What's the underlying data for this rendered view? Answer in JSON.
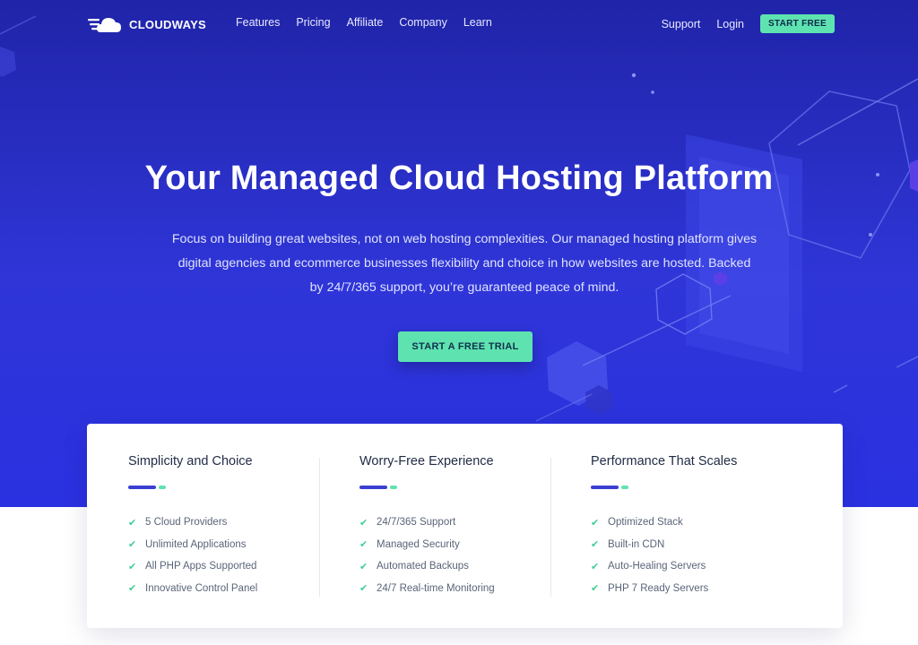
{
  "brand": {
    "name": "CLOUDWAYS"
  },
  "nav": {
    "links": [
      "Features",
      "Pricing",
      "Affiliate",
      "Company",
      "Learn"
    ],
    "support": "Support",
    "login": "Login",
    "cta": "START FREE"
  },
  "hero": {
    "title": "Your Managed Cloud Hosting Platform",
    "subtitle_lines": [
      "Focus on building great websites, not on web hosting complexities. Our managed hosting platform gives",
      "digital agencies and ecommerce businesses flexibility and choice in how websites are hosted. Backed",
      "by 24/7/365 support, you’re guaranteed peace of mind."
    ],
    "cta": "START A FREE TRIAL"
  },
  "features": [
    {
      "title": "Simplicity and Choice",
      "items": [
        "5 Cloud Providers",
        "Unlimited Applications",
        "All PHP Apps Supported",
        "Innovative Control Panel"
      ]
    },
    {
      "title": "Worry-Free Experience",
      "items": [
        "24/7/365 Support",
        "Managed Security",
        "Automated Backups",
        "24/7 Real-time Monitoring"
      ]
    },
    {
      "title": "Performance That Scales",
      "items": [
        "Optimized Stack",
        "Built-in CDN",
        "Auto-Healing Servers",
        "PHP 7 Ready Servers"
      ]
    }
  ],
  "icons": {
    "logo": "cloud-logo-icon",
    "check": "check-icon"
  },
  "colors": {
    "hero_bg": "#2f35d7",
    "accent_green": "#5ee3b0",
    "accent_blue": "#3b3fd1"
  }
}
